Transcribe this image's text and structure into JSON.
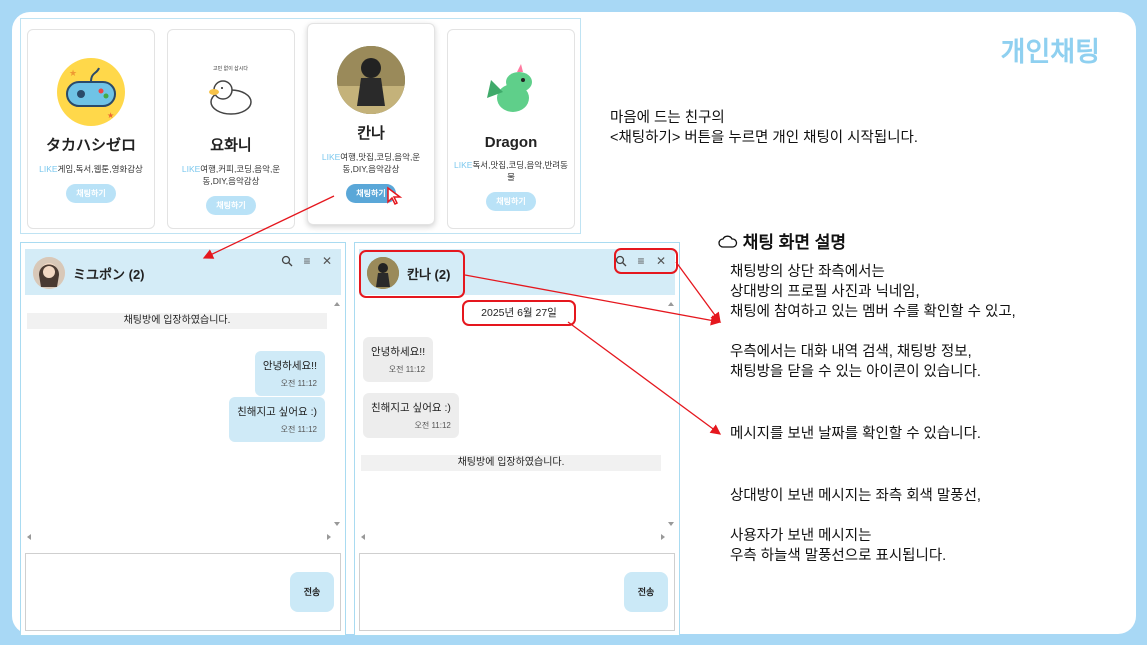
{
  "title": "개인채팅",
  "profiles": [
    {
      "name": "タカハシゼロ",
      "like_prefix": "LIKE",
      "likes": "게임,독서,웹툰,영화감상",
      "button": "채팅하기"
    },
    {
      "name": "요화니",
      "like_prefix": "LIKE",
      "likes": "여행,커피,코딩,음악,운동,DIY,음악감상",
      "button": "채팅하기"
    },
    {
      "name": "칸나",
      "like_prefix": "LIKE",
      "likes": "여행,맛집,코딩,음악,운동,DIY,음악감상",
      "button": "채팅하기"
    },
    {
      "name": "Dragon",
      "like_prefix": "LIKE",
      "likes": "독서,맛집,코딩,음악,반려동물",
      "button": "채팅하기"
    }
  ],
  "intro_text": "마음에 드는 친구의\n<채팅하기> 버튼을 누르면 개인 채팅이 시작됩니다.",
  "section_title": "채팅 화면 설명",
  "desc1": "채팅방의 상단 좌측에서는\n상대방의 프로필 사진과 닉네임,\n채팅에 참여하고 있는 멤버 수를 확인할 수 있고,\n\n우측에서는 대화 내역 검색, 채팅방 정보,\n채팅방을 닫을 수 있는 아이콘이 있습니다.",
  "desc2": "메시지를 보낸 날짜를 확인할 수 있습니다.",
  "desc3": "상대방이 보낸 메시지는 좌측 회색 말풍선,\n\n사용자가 보낸 메시지는\n우측 하늘색 말풍선으로 표시됩니다.",
  "chat_left": {
    "name": "ミユポン (2)",
    "notice": "채팅방에 입장하였습니다.",
    "messages": [
      {
        "text": "안녕하세요!!",
        "time": "오전 11:12"
      },
      {
        "text": "친해지고 싶어요 :)",
        "time": "오전 11:12"
      }
    ],
    "send": "전송"
  },
  "chat_right": {
    "name": "칸나 (2)",
    "date": "2025년 6월 27일",
    "messages": [
      {
        "text": "안녕하세요!!",
        "time": "오전 11:12"
      },
      {
        "text": "친해지고 싶어요 :)",
        "time": "오전 11:12"
      }
    ],
    "notice": "채팅방에 입장하였습니다.",
    "send": "전송"
  },
  "colors": {
    "accent": "#8fd0f0",
    "annotation": "#e5171e",
    "my_bubble": "#cfeaf7",
    "their_bubble": "#ededed"
  }
}
